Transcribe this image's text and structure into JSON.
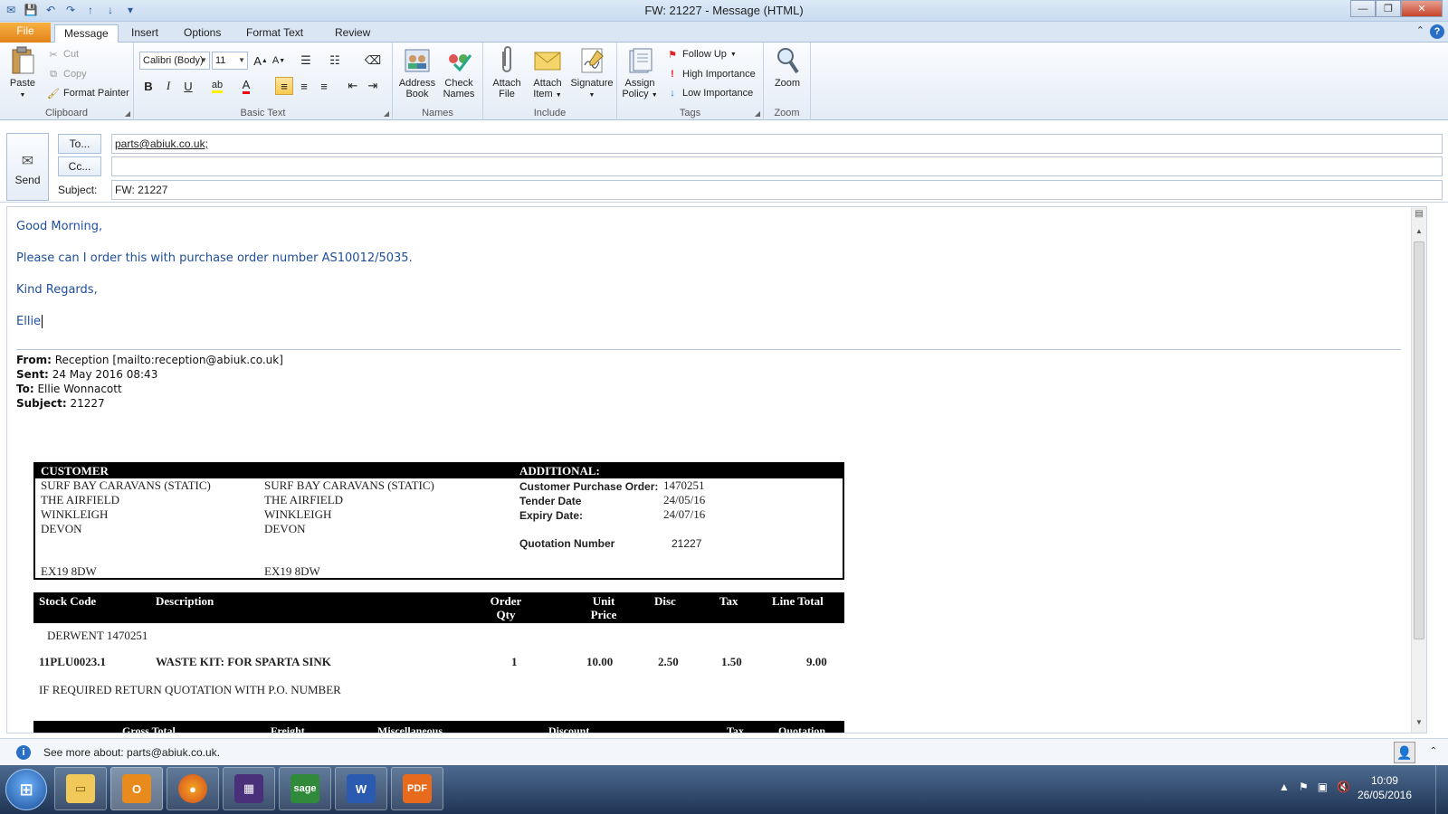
{
  "window": {
    "title": "FW: 21227 - Message (HTML)"
  },
  "ribbon_tabs": [
    "File",
    "Message",
    "Insert",
    "Options",
    "Format Text",
    "Review"
  ],
  "clipboard": {
    "paste": "Paste",
    "cut": "Cut",
    "copy": "Copy",
    "format_painter": "Format Painter",
    "label": "Clipboard"
  },
  "basic_text": {
    "font": "Calibri (Body)",
    "size": "11",
    "label": "Basic Text"
  },
  "names": {
    "address_book": [
      "Address",
      "Book"
    ],
    "check_names": [
      "Check",
      "Names"
    ],
    "label": "Names"
  },
  "include": {
    "attach_file": [
      "Attach",
      "File"
    ],
    "attach_item": [
      "Attach",
      "Item"
    ],
    "signature": "Signature",
    "label": "Include"
  },
  "tags": {
    "assign_policy": [
      "Assign",
      "Policy"
    ],
    "follow_up": "Follow Up",
    "high_importance": "High Importance",
    "low_importance": "Low Importance",
    "label": "Tags"
  },
  "zoom": {
    "zoom": "Zoom",
    "label": "Zoom"
  },
  "compose": {
    "send": "Send",
    "to_button": "To...",
    "cc_button": "Cc...",
    "subject_label": "Subject:",
    "to_value": "parts@abiuk.co.uk;",
    "cc_value": "",
    "subject_value": "FW: 21227"
  },
  "body": {
    "greeting": "Good Morning,",
    "request": "Please can I order this with purchase order number AS10012/5035.",
    "regards": "Kind Regards,",
    "name": "Ellie"
  },
  "forwarded": {
    "from_label": "From:",
    "from_value": "Reception [mailto:reception@abiuk.co.uk]",
    "sent_label": "Sent:",
    "sent_value": "24 May 2016 08:43",
    "to_label": "To:",
    "to_value": "Ellie Wonnacott",
    "subject_label": "Subject:",
    "subject_value": "21227"
  },
  "quote": {
    "customer_heading": "CUSTOMER",
    "additional_heading": "ADDITIONAL:",
    "address_1": [
      "SURF BAY CARAVANS (STATIC)",
      "THE AIRFIELD",
      "WINKLEIGH",
      "DEVON",
      "",
      "EX19 8DW"
    ],
    "address_2": [
      "SURF BAY CARAVANS (STATIC)",
      "THE AIRFIELD",
      "WINKLEIGH",
      "DEVON",
      "",
      "EX19 8DW"
    ],
    "additional": [
      {
        "label": "Customer Purchase Order:",
        "value": "1470251"
      },
      {
        "label": "Tender Date",
        "value": "24/05/16"
      },
      {
        "label": "Expiry Date:",
        "value": "24/07/16"
      },
      {
        "label": "Quotation Number",
        "value": "21227"
      }
    ],
    "columns": {
      "stock_code": "Stock Code",
      "description": "Description",
      "order_qty": [
        "Order",
        "Qty"
      ],
      "unit_price": [
        "Unit",
        "Price"
      ],
      "disc": "Disc",
      "tax": "Tax",
      "line_total": "Line Total"
    },
    "ref_line": "DERWENT 1470251",
    "item": {
      "code": "11PLU0023.1",
      "description": "WASTE KIT: FOR SPARTA  SINK",
      "qty": "1",
      "unit_price": "10.00",
      "disc": "2.50",
      "tax": "1.50",
      "total": "9.00"
    },
    "note": "IF REQUIRED RETURN QUOTATION WITH P.O. NUMBER",
    "totals_columns": [
      "Gross Total",
      "Freight",
      "Miscellaneous",
      "Discount",
      "Tax",
      "Quotation"
    ]
  },
  "infobar": {
    "text": "See more about: parts@abiuk.co.uk."
  },
  "taskbar": {
    "time": "10:09",
    "date": "26/05/2016",
    "apps": [
      "explorer",
      "outlook",
      "firefox",
      "calculator-app",
      "sage",
      "word",
      "pdf"
    ]
  }
}
